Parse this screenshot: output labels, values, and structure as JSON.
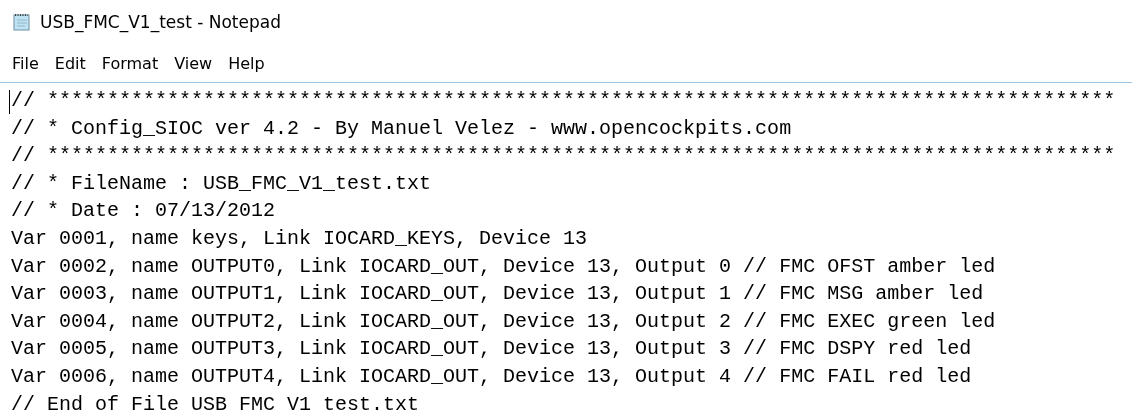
{
  "window": {
    "title": "USB_FMC_V1_test - Notepad"
  },
  "menu": [
    "File",
    "Edit",
    "Format",
    "View",
    "Help"
  ],
  "editor": {
    "lines": [
      "// *****************************************************************************************",
      "// * Config_SIOC ver 4.2 - By Manuel Velez - www.opencockpits.com",
      "// *****************************************************************************************",
      "// * FileName : USB_FMC_V1_test.txt",
      "// * Date : 07/13/2012",
      "Var 0001, name keys, Link IOCARD_KEYS, Device 13",
      "Var 0002, name OUTPUT0, Link IOCARD_OUT, Device 13, Output 0 // FMC OFST amber led",
      "Var 0003, name OUTPUT1, Link IOCARD_OUT, Device 13, Output 1 // FMC MSG amber led",
      "Var 0004, name OUTPUT2, Link IOCARD_OUT, Device 13, Output 2 // FMC EXEC green led",
      "Var 0005, name OUTPUT3, Link IOCARD_OUT, Device 13, Output 3 // FMC DSPY red led",
      "Var 0006, name OUTPUT4, Link IOCARD_OUT, Device 13, Output 4 // FMC FAIL red led",
      "// End of File USB FMC V1 test.txt"
    ]
  }
}
